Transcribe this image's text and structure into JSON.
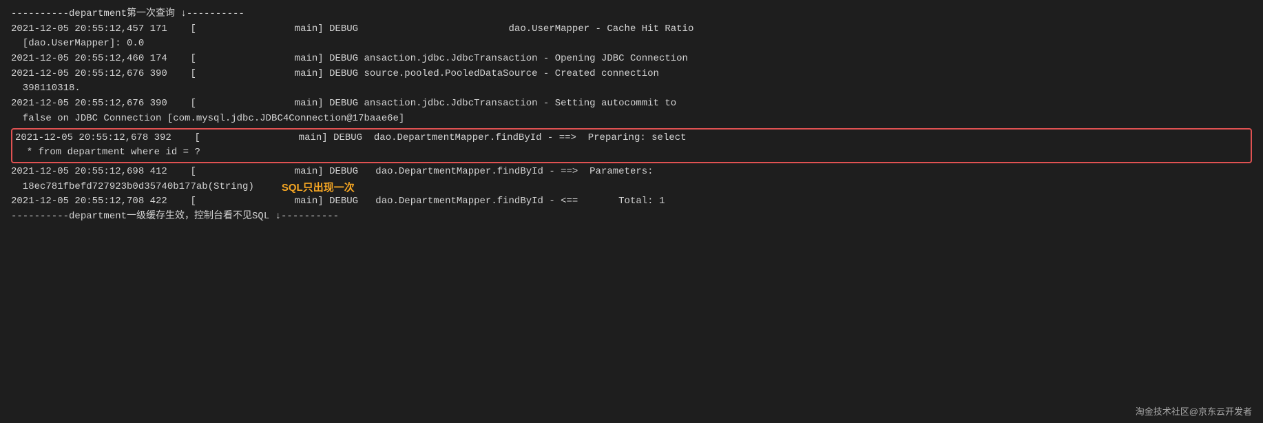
{
  "log": {
    "separator_top": "----------department第一次查询 ↓----------",
    "lines": [
      {
        "id": "line1",
        "text": "2021-12-05 20:55:12,457 171    [                 main] DEBUG                          dao.UserMapper - Cache Hit Ratio",
        "indent": false,
        "highlight": false
      },
      {
        "id": "line1b",
        "text": "  [dao.UserMapper]: 0.0",
        "indent": false,
        "highlight": false
      },
      {
        "id": "line2",
        "text": "2021-12-05 20:55:12,460 174    [                 main] DEBUG ansaction.jdbc.JdbcTransaction - Opening JDBC Connection",
        "indent": false,
        "highlight": false
      },
      {
        "id": "line3",
        "text": "2021-12-05 20:55:12,676 390    [                 main] DEBUG source.pooled.PooledDataSource - Created connection",
        "indent": false,
        "highlight": false
      },
      {
        "id": "line3b",
        "text": "  398110318.",
        "indent": false,
        "highlight": false
      },
      {
        "id": "line4",
        "text": "2021-12-05 20:55:12,676 390    [                 main] DEBUG ansaction.jdbc.JdbcTransaction - Setting autocommit to",
        "indent": false,
        "highlight": false
      },
      {
        "id": "line4b",
        "text": "  false on JDBC Connection [com.mysql.jdbc.JDBC4Connection@17baae6e]",
        "indent": false,
        "highlight": false
      }
    ],
    "highlighted_lines": [
      {
        "id": "hline1",
        "text": "2021-12-05 20:55:12,678 392    [                 main] DEBUG  dao.DepartmentMapper.findById - ==>  Preparing: select"
      },
      {
        "id": "hline2",
        "text": "  * from department where id = ?"
      }
    ],
    "lines2": [
      {
        "id": "line5",
        "text": "2021-12-05 20:55:12,698 412    [                 main] DEBUG   dao.DepartmentMapper.findById - ==>  Parameters:"
      },
      {
        "id": "line5b",
        "text": "  18ec781fbefd727923b0d35740b177ab(String)"
      },
      {
        "id": "line6",
        "text": "2021-12-05 20:55:12,708 422    [                 main] DEBUG   dao.DepartmentMapper.findById - <==       Total: 1"
      }
    ],
    "sql_annotation": "SQL只出现一次",
    "separator_bottom": "----------department一级缓存生效，控制台看不见SQL ↓----------",
    "watermark": "淘金技术社区@京东云开发者"
  }
}
